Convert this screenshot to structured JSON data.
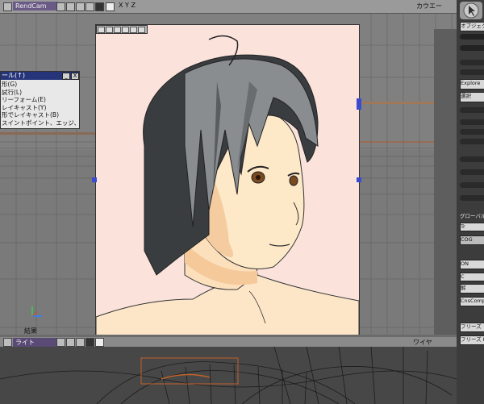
{
  "top_viewport": {
    "camera_label": "RendCam",
    "axes_label": "X Y Z",
    "right_label": "カウエー"
  },
  "render_window": {
    "status_label": "結果"
  },
  "menu": {
    "title": "ール(↑)",
    "minimize": "_",
    "close": "X",
    "items": [
      "形(G)",
      "試行(L)",
      "リーフォーム(E)",
      "レイキャスト(Y)",
      "形でレイキャスト(B)",
      "スイントポイント、エッジ、ポリゴン(B)"
    ]
  },
  "bottom_viewport": {
    "light_label": "ライト",
    "wire_label": "ワイヤ"
  },
  "right_panel": {
    "object_tab": "オブジェクト",
    "explore_button": "Explore",
    "select_button": "選択",
    "global_label": "グローバル",
    "tr_label": "Tr",
    "cog_label": "COG",
    "on_toggle": "ON",
    "c_label": "C",
    "unlock_label": "解",
    "cns_comp_button": "CnsComp",
    "freeze_button": "フリーズ",
    "freeze_m_button": "フリーズ M"
  },
  "colors": {
    "viewport_bg": "#777777",
    "render_bg": "#fbe3dc",
    "menu_titlebar": "#26347a",
    "camera_tag": "#6a5a86"
  }
}
